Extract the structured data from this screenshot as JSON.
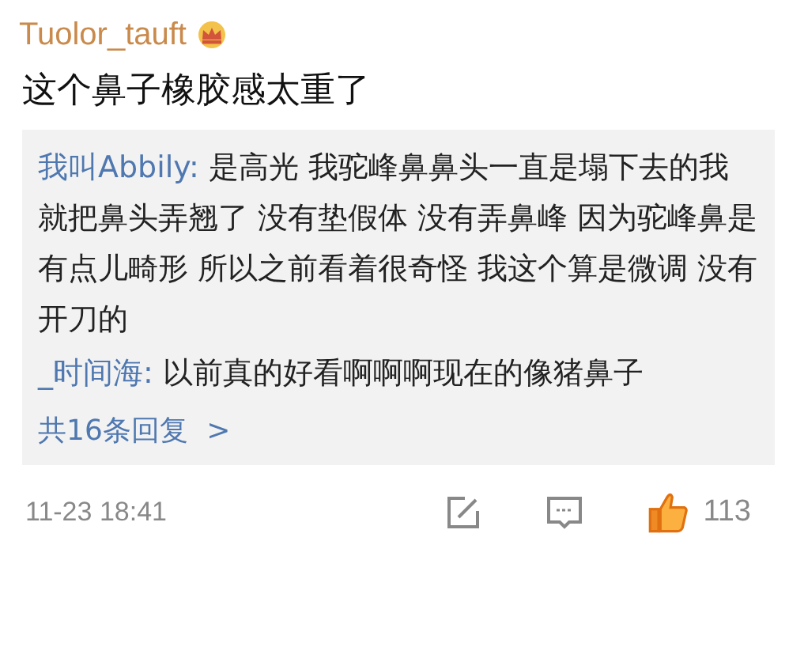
{
  "comment": {
    "username": "Tuolor_tauft",
    "text": "这个鼻子橡胶感太重了"
  },
  "replies": [
    {
      "name": "我叫Abbily:",
      "text": "是高光 我驼峰鼻鼻头一直是塌下去的我就把鼻头弄翘了 没有垫假体 没有弄鼻峰 因为驼峰鼻是有点儿畸形 所以之前看着很奇怪 我这个算是微调 没有开刀的"
    },
    {
      "name": "_时间海:",
      "text": "以前真的好看啊啊啊现在的像猪鼻子"
    }
  ],
  "more_replies": {
    "label": "共16条回复",
    "icon": ">"
  },
  "footer": {
    "time": "11-23 18:41",
    "likes": "113",
    "liked": true
  }
}
